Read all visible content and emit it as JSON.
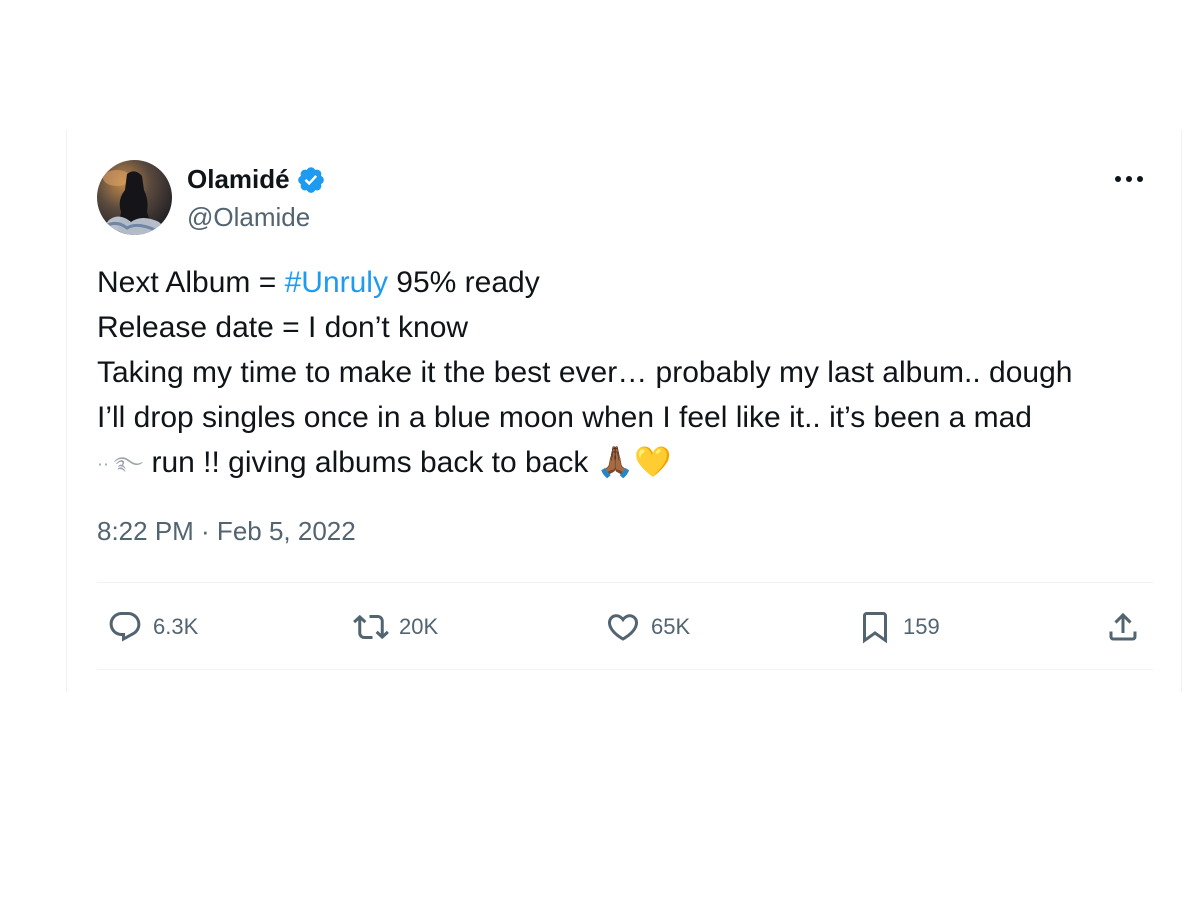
{
  "user": {
    "display_name": "Olamidé",
    "handle": "@Olamide",
    "verified": true
  },
  "tweet": {
    "line1_prefix": "Next Album = ",
    "hashtag": "#Unruly",
    "line1_suffix": " 95% ready",
    "line2": "Release date = I don’t know",
    "line3": "Taking my time to make it the best ever… probably my last album.. dough",
    "line4": "I’ll drop singles once in a blue moon when I feel like it.. it’s been a mad",
    "line5_prefix": "·· ࿐",
    "line5": "run !! giving albums back to back",
    "emojis": "🙏🏾💛"
  },
  "timestamp": "8:22 PM · Feb 5, 2022",
  "actions": {
    "replies": "6.3K",
    "retweets": "20K",
    "likes": "65K",
    "bookmarks": "159"
  },
  "icons": {
    "verified": "verified-badge-icon",
    "more": "more-icon",
    "reply": "reply-icon",
    "retweet": "retweet-icon",
    "like": "heart-icon",
    "bookmark": "bookmark-icon",
    "share": "share-icon"
  },
  "colors": {
    "accent": "#1d9bf0",
    "text": "#0f1419",
    "secondary": "#536471",
    "divider": "#eff3f4"
  }
}
